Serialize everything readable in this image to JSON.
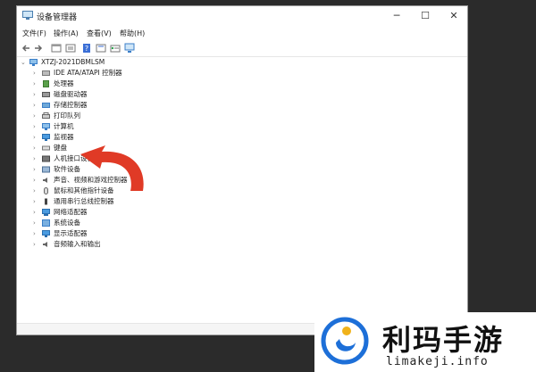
{
  "window": {
    "title": "设备管理器",
    "controls": {
      "minimize": "─",
      "maximize": "☐",
      "close": "✕"
    }
  },
  "menu": {
    "items": [
      "文件(F)",
      "操作(A)",
      "查看(V)",
      "帮助(H)"
    ]
  },
  "tree": {
    "root": "XTZJ-2021DBMLSM",
    "items": [
      "IDE ATA/ATAPI 控制器",
      "处理器",
      "磁盘驱动器",
      "存储控制器",
      "打印队列",
      "计算机",
      "监视器",
      "键盘",
      "人机接口设备",
      "软件设备",
      "声音、视频和游戏控制器",
      "鼠标和其他指针设备",
      "通用串行总线控制器",
      "网络适配器",
      "系统设备",
      "显示适配器",
      "音频输入和输出"
    ]
  },
  "watermark": {
    "name": "利玛手游",
    "url": "limakeji.info"
  },
  "colors": {
    "arrow": "#e03a26",
    "logo_blue": "#1d6fd8",
    "logo_gold": "#f0b21a"
  }
}
